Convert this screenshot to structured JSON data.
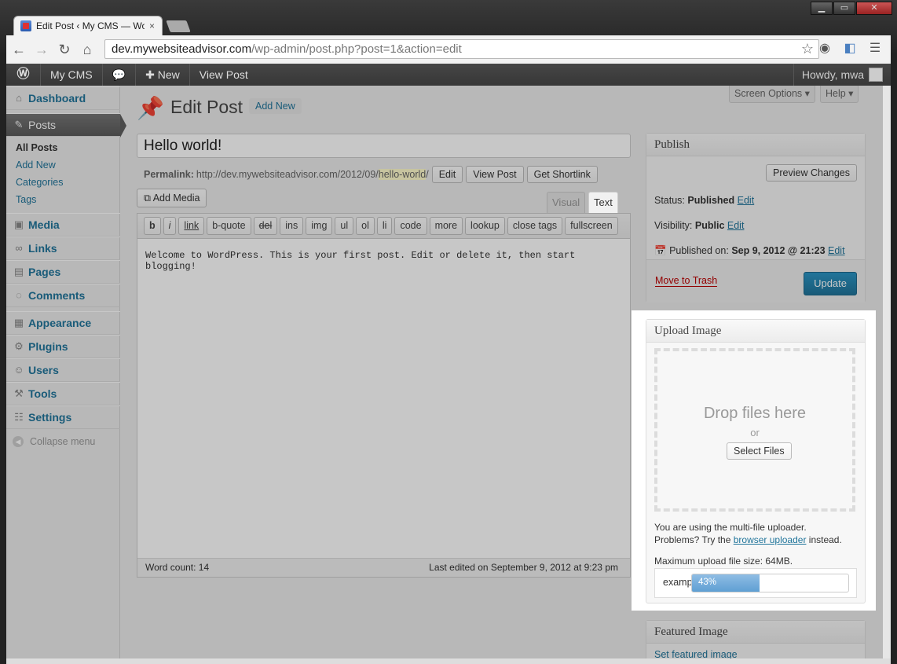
{
  "browser": {
    "tab_title": "Edit Post ‹ My CMS — Wo",
    "tab_close": "×",
    "url_domain": "dev.mywebsiteadvisor.com",
    "url_path": "/wp-admin/post.php?post=1&action=edit"
  },
  "adminbar": {
    "site": "My CMS",
    "new": "New",
    "view_post": "View Post",
    "howdy": "Howdy, mwa"
  },
  "sidebar": {
    "dashboard": "Dashboard",
    "posts": "Posts",
    "sub": [
      "All Posts",
      "Add New",
      "Categories",
      "Tags"
    ],
    "media": "Media",
    "links": "Links",
    "pages": "Pages",
    "comments": "Comments",
    "appearance": "Appearance",
    "plugins": "Plugins",
    "users": "Users",
    "tools": "Tools",
    "settings": "Settings",
    "collapse": "Collapse menu"
  },
  "header": {
    "title": "Edit Post",
    "add_new": "Add New",
    "screen_options": "Screen Options ▾",
    "help": "Help ▾"
  },
  "post": {
    "title": "Hello world!",
    "permalink_label": "Permalink:",
    "permalink_base": "http://dev.mywebsiteadvisor.com/2012/09/",
    "permalink_slug": "hello-world",
    "permalink_end": "/",
    "edit": "Edit",
    "view_post": "View Post",
    "get_shortlink": "Get Shortlink",
    "add_media": "Add Media",
    "tab_visual": "Visual",
    "tab_text": "Text",
    "quicktags": [
      "b",
      "i",
      "link",
      "b-quote",
      "del",
      "ins",
      "img",
      "ul",
      "ol",
      "li",
      "code",
      "more",
      "lookup",
      "close tags",
      "fullscreen"
    ],
    "content": "Welcome to WordPress. This is your first post. Edit or delete it, then start blogging!",
    "word_count": "Word count: 14",
    "last_edited": "Last edited on September 9, 2012 at 9:23 pm"
  },
  "publish": {
    "title": "Publish",
    "preview": "Preview Changes",
    "status_label": "Status:",
    "status_value": "Published",
    "visibility_label": "Visibility:",
    "visibility_value": "Public",
    "published_label": "Published on:",
    "published_value": "Sep 9, 2012 @ 21:23",
    "edit": "Edit",
    "trash": "Move to Trash",
    "update": "Update"
  },
  "upload": {
    "title": "Upload Image",
    "drop": "Drop files here",
    "or": "or",
    "select": "Select Files",
    "info1": "You are using the multi-file uploader.",
    "info2_pre": "Problems? Try the ",
    "info2_link": "browser uploader",
    "info2_post": " instead.",
    "max": "Maximum upload file size: 64MB.",
    "file_name": "examp",
    "progress_label": "43%",
    "progress": 0.43
  },
  "featured": {
    "title": "Featured Image",
    "link": "Set featured image"
  }
}
